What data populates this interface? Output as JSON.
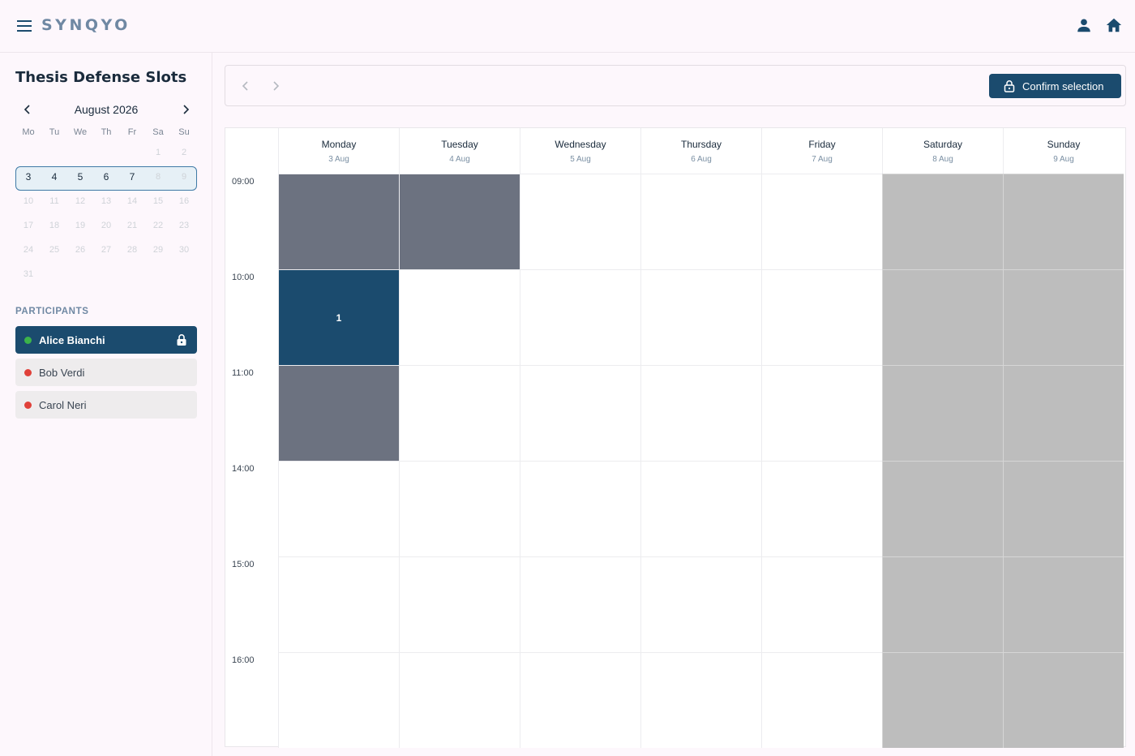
{
  "app": {
    "brand": "SYNQYO"
  },
  "sidebar": {
    "title": "Thesis Defense Slots",
    "calendar": {
      "month_label": "August 2026",
      "weekdays": [
        "Mo",
        "Tu",
        "We",
        "Th",
        "Fr",
        "Sa",
        "Su"
      ],
      "weeks": [
        [
          "",
          "",
          "",
          "",
          "",
          "1",
          "2"
        ],
        [
          "3",
          "4",
          "5",
          "6",
          "7",
          "8",
          "9"
        ],
        [
          "10",
          "11",
          "12",
          "13",
          "14",
          "15",
          "16"
        ],
        [
          "17",
          "18",
          "19",
          "20",
          "21",
          "22",
          "23"
        ],
        [
          "24",
          "25",
          "26",
          "27",
          "28",
          "29",
          "30"
        ],
        [
          "31",
          "",
          "",
          "",
          "",
          "",
          ""
        ]
      ],
      "active_days": [
        "3",
        "4",
        "5",
        "6",
        "7"
      ]
    },
    "participants_heading": "PARTICIPANTS",
    "participants": [
      {
        "name": "Alice Bianchi",
        "status_color": "#3cb34a",
        "selected": true,
        "locked": true
      },
      {
        "name": "Bob Verdi",
        "status_color": "#e0413a",
        "selected": false,
        "locked": false
      },
      {
        "name": "Carol Neri",
        "status_color": "#e0413a",
        "selected": false,
        "locked": false
      }
    ]
  },
  "toolbar": {
    "prev_icon": "chevron-left-icon",
    "next_icon": "chevron-right-icon",
    "confirm_label": "Confirm selection",
    "confirm_icon": "lock-icon"
  },
  "schedule": {
    "days": [
      {
        "name": "Monday",
        "date": "3 Aug"
      },
      {
        "name": "Tuesday",
        "date": "4 Aug"
      },
      {
        "name": "Wednesday",
        "date": "5 Aug"
      },
      {
        "name": "Thursday",
        "date": "6 Aug"
      },
      {
        "name": "Friday",
        "date": "7 Aug"
      },
      {
        "name": "Saturday",
        "date": "8 Aug"
      },
      {
        "name": "Sunday",
        "date": "9 Aug"
      }
    ],
    "time_slots": [
      "09:00",
      "10:00",
      "11:00",
      "14:00",
      "15:00",
      "16:00"
    ],
    "slot_states": [
      [
        "busy",
        "busy",
        "free",
        "free",
        "free",
        "weekend",
        "weekend"
      ],
      [
        "selected",
        "free",
        "free",
        "free",
        "free",
        "weekend",
        "weekend"
      ],
      [
        "busy",
        "free",
        "free",
        "free",
        "free",
        "weekend",
        "weekend"
      ],
      [
        "free",
        "free",
        "free",
        "free",
        "free",
        "weekend",
        "weekend"
      ],
      [
        "free",
        "free",
        "free",
        "free",
        "free",
        "weekend",
        "weekend"
      ],
      [
        "free",
        "free",
        "free",
        "free",
        "free",
        "weekend",
        "weekend"
      ]
    ],
    "selected_slot_label": "1",
    "colors": {
      "busy": "#6c7280",
      "selected": "#1b4b6e",
      "weekend": "#bdbdbd",
      "free": "#ffffff"
    }
  }
}
